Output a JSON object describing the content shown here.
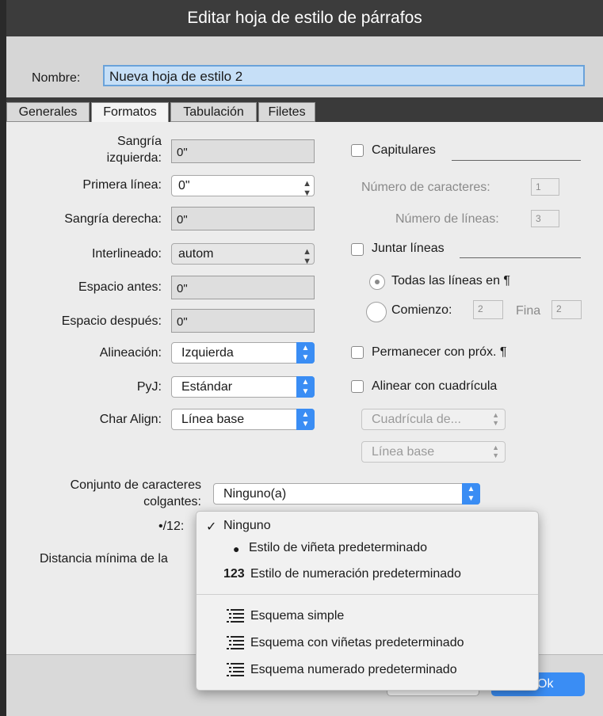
{
  "window": {
    "title": "Editar hoja de estilo de párrafos"
  },
  "name_field": {
    "label": "Nombre:",
    "value": "Nueva hoja de estilo 2"
  },
  "tabs": [
    "Generales",
    "Formatos",
    "Tabulación",
    "Filetes"
  ],
  "active_tab": "Formatos",
  "left": {
    "sangria_izq_label_1": "Sangría",
    "sangria_izq_label_2": "izquierda:",
    "sangria_izq_value": "0\"",
    "primera_linea_label": "Primera línea:",
    "primera_linea_value": "0\"",
    "sangria_der_label": "Sangría derecha:",
    "sangria_der_value": "0\"",
    "interlineado_label": "Interlineado:",
    "interlineado_value": "autom",
    "espacio_antes_label": "Espacio antes:",
    "espacio_antes_value": "0\"",
    "espacio_despues_label": "Espacio después:",
    "espacio_despues_value": "0\"",
    "alineacion_label": "Alineación:",
    "alineacion_value": "Izquierda",
    "pyj_label": "PyJ:",
    "pyj_value": "Estándar",
    "char_align_label": "Char Align:",
    "char_align_value": "Línea base"
  },
  "right": {
    "capitulares_label": "Capitulares",
    "num_caracteres_label": "Número de caracteres:",
    "num_caracteres_value": "1",
    "num_lineas_label": "Número de líneas:",
    "num_lineas_value": "3",
    "juntar_label": "Juntar líneas",
    "todas_label": "Todas las líneas en ¶",
    "comienzo_label": "Comienzo:",
    "comienzo_value": "2",
    "fina_label": "Fina",
    "fina_value": "2",
    "permanecer_label": "Permanecer con próx. ¶",
    "alinear_label": "Alinear con cuadrícula",
    "cuadricula_value": "Cuadrícula de...",
    "linea_base_value": "Línea base"
  },
  "hanging": {
    "label_1": "Conjunto de caracteres",
    "label_2": "colgantes:",
    "value": "Ninguno(a)"
  },
  "bullets": {
    "label": "•/12:"
  },
  "distancia": {
    "label": "Distancia mínima de la"
  },
  "menu": {
    "items": [
      {
        "label": "Ninguno",
        "checked": true
      },
      {
        "label": "Estilo de viñeta predeterminado",
        "prefix": "●"
      },
      {
        "label": "Estilo de numeración predeterminado",
        "prefix": "123"
      }
    ],
    "outline_items": [
      "Esquema simple",
      "Esquema con viñetas predeterminado",
      "Esquema numerado predeterminado"
    ],
    "check": "✓"
  },
  "footer": {
    "ok_fragment": "Ok"
  },
  "colors": {
    "accent": "#3a8df4",
    "title_bar": "#3c3c3c",
    "name_field_bg": "#c6dff7"
  }
}
